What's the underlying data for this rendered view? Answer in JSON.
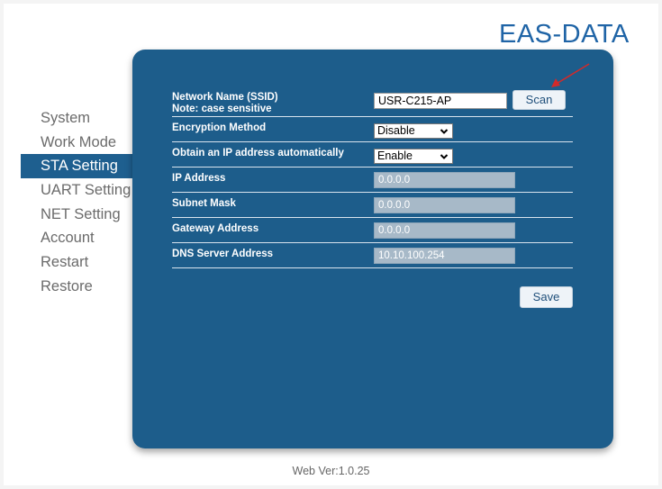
{
  "brand": "EAS-DATA",
  "nav": [
    {
      "label": "System"
    },
    {
      "label": "Work Mode"
    },
    {
      "label": "STA Setting",
      "active": true
    },
    {
      "label": "UART Setting"
    },
    {
      "label": "NET Setting"
    },
    {
      "label": "Account"
    },
    {
      "label": "Restart"
    },
    {
      "label": "Restore"
    }
  ],
  "form": {
    "ssid": {
      "label": "Network Name  (SSID)",
      "note": "Note: case sensitive",
      "value": "USR-C215-AP"
    },
    "scan_label": "Scan",
    "encryption": {
      "label": "Encryption Method",
      "value": "Disable"
    },
    "dhcp": {
      "label": "Obtain an IP address automatically",
      "value": "Enable"
    },
    "ip": {
      "label": "IP Address",
      "value": "0.0.0.0"
    },
    "mask": {
      "label": "Subnet Mask",
      "value": "0.0.0.0"
    },
    "gateway": {
      "label": "Gateway Address",
      "value": "0.0.0.0"
    },
    "dns": {
      "label": "DNS Server Address",
      "value": "10.10.100.254"
    },
    "save_label": "Save"
  },
  "footer": "Web Ver:1.0.25",
  "colors": {
    "panel": "#1d5d8b",
    "brand": "#1f64a6",
    "active_nav": "#1e5f8f",
    "annotation_arrow": "#d22a2a"
  },
  "icons": {
    "dropdown": "chevron-down-icon",
    "annotation": "red-arrow-annotation"
  }
}
